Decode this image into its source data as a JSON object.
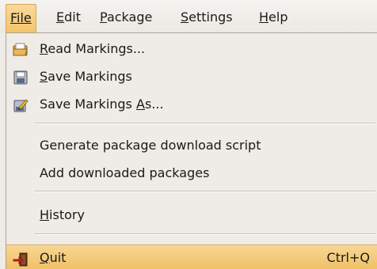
{
  "menubar": {
    "items": [
      {
        "label": "File"
      },
      {
        "label": "Edit"
      },
      {
        "label": "Package"
      },
      {
        "label": "Settings"
      },
      {
        "label": "Help"
      }
    ]
  },
  "file_menu": {
    "items": [
      {
        "label": "Read Markings...",
        "icon": "folder-open-icon"
      },
      {
        "label": "Save Markings",
        "icon": "floppy-disk-icon"
      },
      {
        "label": "Save Markings As...",
        "icon": "save-as-pencil-icon"
      },
      {
        "label": "Generate package download script"
      },
      {
        "label": "Add downloaded packages"
      },
      {
        "label": "History"
      },
      {
        "label": "Quit",
        "icon": "exit-door-icon",
        "accelerator": "Ctrl+Q"
      }
    ]
  },
  "colors": {
    "menu_background": "#efebe7",
    "highlight": "#f3c46a",
    "separator": "#c4bfb8"
  }
}
